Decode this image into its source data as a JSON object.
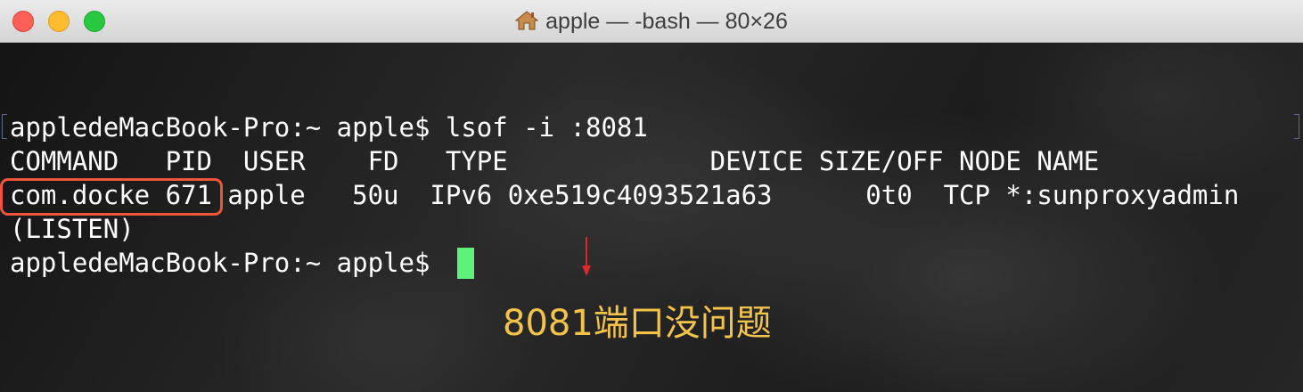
{
  "window": {
    "title": "apple — -bash — 80×26",
    "title_icon": "home-icon",
    "traffic_lights": {
      "close": "#fe5f57",
      "minimize": "#febc2e",
      "maximize": "#28c840"
    }
  },
  "terminal": {
    "lines": [
      "appledeMacBook-Pro:~ apple$ lsof -i :8081",
      "COMMAND   PID  USER    FD   TYPE             DEVICE SIZE/OFF NODE NAME",
      "com.docke 671 apple   50u  IPv6 0xe519c4093521a63      0t0  TCP *:sunproxyadmin",
      "(LISTEN)",
      "appledeMacBook-Pro:~ apple$ "
    ],
    "cursor_color": "#5ff27a",
    "text_color": "#ffffff"
  },
  "annotation": {
    "text": "8081端口没问题",
    "text_color": "#f3c34a",
    "highlight_color": "#f0553a",
    "arrow_color": "#e0262a"
  }
}
